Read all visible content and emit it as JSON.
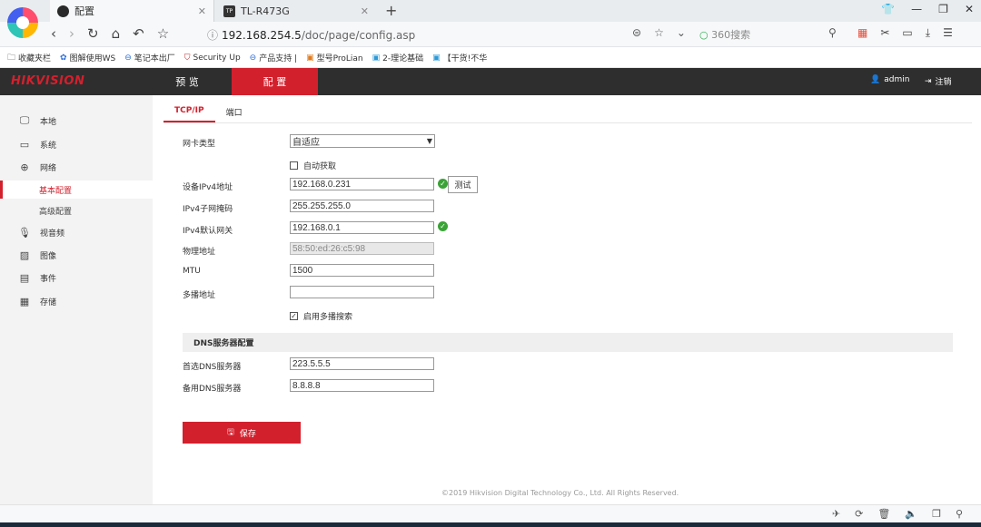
{
  "browser": {
    "tabs": [
      {
        "label": "配置",
        "active": true
      },
      {
        "label": "TL-R473G",
        "active": false
      }
    ],
    "tp_badge": "TP",
    "url_host": "192.168.254.5",
    "url_path": "/doc/page/config.asp",
    "search_placeholder": "360搜索",
    "bookmarks": [
      "收藏夹栏",
      "图解使用WS",
      "笔记本出厂",
      "Security Up",
      "产品支持 |",
      "型号ProLian",
      "2-理论基础",
      "【干货!不华"
    ]
  },
  "header": {
    "logo": "HIKVISION",
    "nav": {
      "preview": "预 览",
      "config": "配 置"
    },
    "user": "admin",
    "logout": "注销"
  },
  "sidebar": {
    "items": [
      {
        "label": "本地",
        "icon": "monitor-icon"
      },
      {
        "label": "系统",
        "icon": "system-icon"
      },
      {
        "label": "网络",
        "icon": "globe-icon"
      },
      {
        "label": "视音频",
        "icon": "audio-video-icon"
      },
      {
        "label": "图像",
        "icon": "image-icon"
      },
      {
        "label": "事件",
        "icon": "calendar-icon"
      },
      {
        "label": "存储",
        "icon": "storage-icon"
      }
    ],
    "subitems": {
      "basic": "基本配置",
      "advanced": "高级配置"
    }
  },
  "main": {
    "tabs": {
      "tcpip": "TCP/IP",
      "port": "端口"
    },
    "nic_type_label": "网卡类型",
    "nic_type_value": "自适应",
    "dhcp_label": "自动获取",
    "ipv4_label": "设备IPv4地址",
    "ipv4_value": "192.168.0.231",
    "test_label": "测试",
    "mask_label": "IPv4子网掩码",
    "mask_value": "255.255.255.0",
    "gateway_label": "IPv4默认网关",
    "gateway_value": "192.168.0.1",
    "mac_label": "物理地址",
    "mac_value": "58:50:ed:26:c5:98",
    "mtu_label": "MTU",
    "mtu_value": "1500",
    "multicast_label": "多播地址",
    "multicast_value": "",
    "multicast_search_label": "启用多播搜索",
    "dns_section": "DNS服务器配置",
    "dns1_label": "首选DNS服务器",
    "dns1_value": "223.5.5.5",
    "dns2_label": "备用DNS服务器",
    "dns2_value": "8.8.8.8",
    "save_label": "保存",
    "footer": "©2019 Hikvision Digital Technology Co., Ltd. All Rights Reserved."
  },
  "colors": {
    "accent": "#d3202d",
    "header_bg": "#2e2e2e",
    "ok": "#3aa336"
  }
}
